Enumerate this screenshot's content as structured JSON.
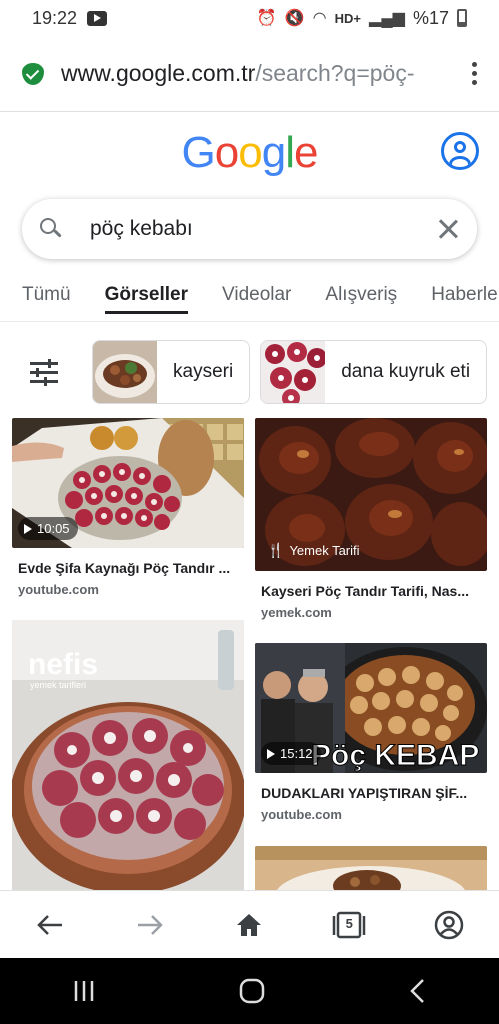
{
  "status_bar": {
    "time": "19:22",
    "network": "HD+",
    "battery": "%17"
  },
  "browser": {
    "url_host": "www.google.com.tr",
    "url_path": "/search?q=pöç-"
  },
  "google": {
    "logo": [
      "G",
      "o",
      "o",
      "g",
      "l",
      "e"
    ],
    "logo_colors": [
      "#4285f4",
      "#ea4335",
      "#fbbc05",
      "#4285f4",
      "#34a853",
      "#ea4335"
    ]
  },
  "search": {
    "query": "pöç kebabı"
  },
  "tabs": [
    {
      "label": "Tümü"
    },
    {
      "label": "Görseller",
      "active": true
    },
    {
      "label": "Videolar"
    },
    {
      "label": "Alışveriş"
    },
    {
      "label": "Haberler"
    }
  ],
  "chips": [
    {
      "label": "kayseri"
    },
    {
      "label": "dana kuyruk eti"
    }
  ],
  "results": [
    {
      "title": "Evde Şifa Kaynağı Pöç Tandır ...",
      "source": "youtube.com",
      "badge": "10:05",
      "badge_icon": "play-icon"
    },
    {
      "title": "Kayseri Pöç Tandır Tarifi, Nas...",
      "source": "yemek.com",
      "badge": "Yemek Tarifi",
      "badge_icon": "fork-knife-icon"
    },
    {
      "title": "DUDAKLARI YAPIŞTIRAN ŞİF...",
      "source": "youtube.com",
      "badge": "15:12",
      "badge_icon": "play-icon"
    }
  ],
  "overlay_text": {
    "nefis": "nefis",
    "nefis_sub": "yemek tarifleri",
    "kebap": "Pöç KEBAP"
  },
  "bottom_nav": {
    "tab_count": "5"
  },
  "colors": {
    "accent": "#1a73e8",
    "secure": "#1e8e3e"
  }
}
